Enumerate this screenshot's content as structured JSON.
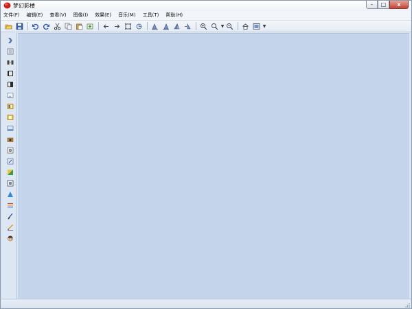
{
  "window": {
    "title": "梦幻影楼"
  },
  "menu": [
    {
      "label": "文件(F)"
    },
    {
      "label": "编辑(E)"
    },
    {
      "label": "查看(V)"
    },
    {
      "label": "图像(I)"
    },
    {
      "label": "效果(E)"
    },
    {
      "label": "音乐(M)"
    },
    {
      "label": "工具(T)"
    },
    {
      "label": "帮助(H)"
    }
  ],
  "toolbar": [
    {
      "icon": "open-folder-icon"
    },
    {
      "icon": "save-icon"
    },
    {
      "icon": "undo-icon"
    },
    {
      "icon": "redo-icon"
    },
    {
      "icon": "cut-icon"
    },
    {
      "icon": "copy-icon"
    },
    {
      "icon": "paste-icon"
    },
    {
      "icon": "add-image-icon"
    },
    {
      "icon": "previous-icon"
    },
    {
      "icon": "next-icon"
    },
    {
      "icon": "fit-window-icon"
    },
    {
      "icon": "rotate-icon"
    },
    {
      "icon": "align-left-icon"
    },
    {
      "icon": "align-center-icon"
    },
    {
      "icon": "align-right-icon"
    },
    {
      "icon": "align-flip-icon"
    },
    {
      "icon": "zoom-in-icon"
    },
    {
      "icon": "zoom-icon"
    },
    {
      "icon": "zoom-out-icon"
    },
    {
      "icon": "home-icon"
    },
    {
      "icon": "display-mode-icon"
    }
  ],
  "side_tools": [
    {
      "icon": "navigator-icon"
    },
    {
      "icon": "frame-list-icon"
    },
    {
      "icon": "transition-icon"
    },
    {
      "icon": "film-icon"
    },
    {
      "icon": "film-strip-icon"
    },
    {
      "icon": "photo-icon"
    },
    {
      "icon": "album-icon"
    },
    {
      "icon": "album-alt-icon"
    },
    {
      "icon": "scene-icon"
    },
    {
      "icon": "camera-icon"
    },
    {
      "icon": "sound-icon"
    },
    {
      "icon": "edit-frame-icon"
    },
    {
      "icon": "gradient-icon"
    },
    {
      "icon": "photo-frame-icon"
    },
    {
      "icon": "triangle-shape-icon"
    },
    {
      "icon": "text-lines-icon"
    },
    {
      "icon": "brush-icon"
    },
    {
      "icon": "pencil-icon"
    },
    {
      "icon": "character-icon"
    }
  ]
}
